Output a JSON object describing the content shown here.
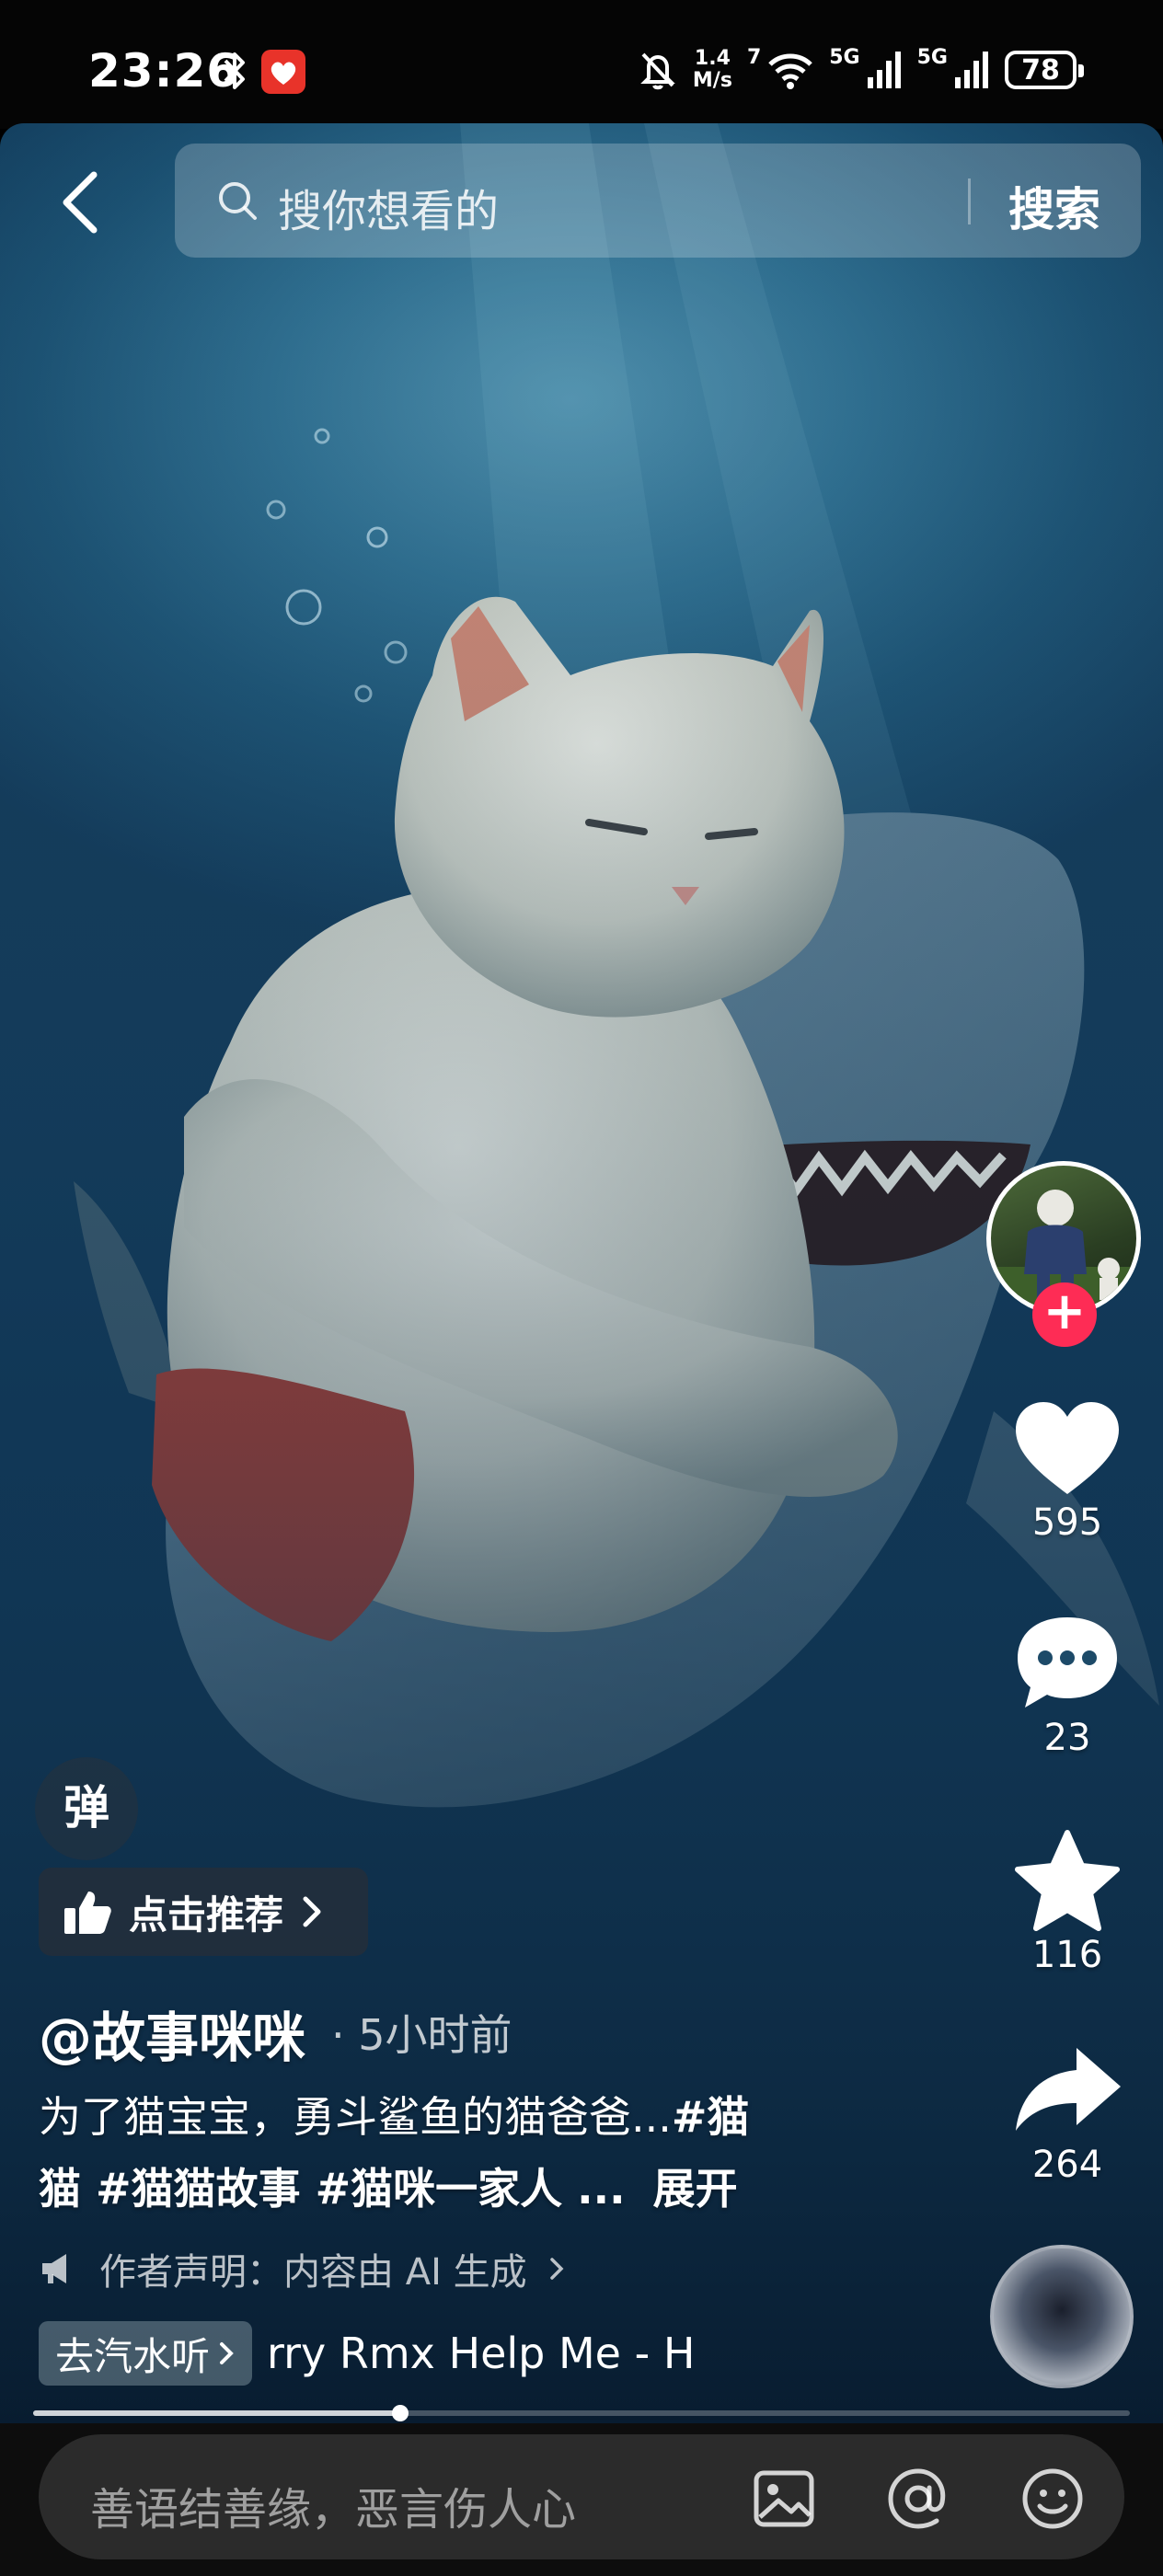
{
  "status_bar": {
    "time": "23:26",
    "net_speed_value": "1.4",
    "net_speed_unit": "M/s",
    "wifi_label": "7",
    "signal1_label": "5G",
    "signal2_label": "5G",
    "battery": "78"
  },
  "search": {
    "placeholder": "搜你想看的",
    "button_label": "搜索"
  },
  "actions": {
    "likes": "595",
    "comments": "23",
    "favorites": "116",
    "shares": "264"
  },
  "left": {
    "danmu_label": "弹",
    "recommend_label": "点击推荐"
  },
  "post": {
    "author": "@故事咪咪",
    "time": "· 5小时前",
    "caption_line1_text": "为了猫宝宝，勇斗鲨鱼的猫爸爸...",
    "caption_line1_tag": "#猫",
    "caption_line2_text": "猫 #猫猫故事 #猫咪一家人 ...",
    "expand_label": "展开",
    "ai_notice": "作者声明：内容由 AI 生成",
    "music_tag": "去汽水听",
    "music_title": "rry Rmx    Help Me - H"
  },
  "playback": {
    "progress": 0.335
  },
  "comment_bar": {
    "placeholder": "善语结善缘，恶言伤人心"
  },
  "icons": [
    "bluetooth-icon",
    "app-badge-icon",
    "mute-icon",
    "wifi-icon",
    "signal-icon",
    "back-icon",
    "search-icon",
    "heart-icon",
    "comment-icon",
    "star-icon",
    "share-icon",
    "thumbs-up-icon",
    "chevron-right-icon",
    "megaphone-icon",
    "image-icon",
    "at-icon",
    "emoji-icon"
  ]
}
